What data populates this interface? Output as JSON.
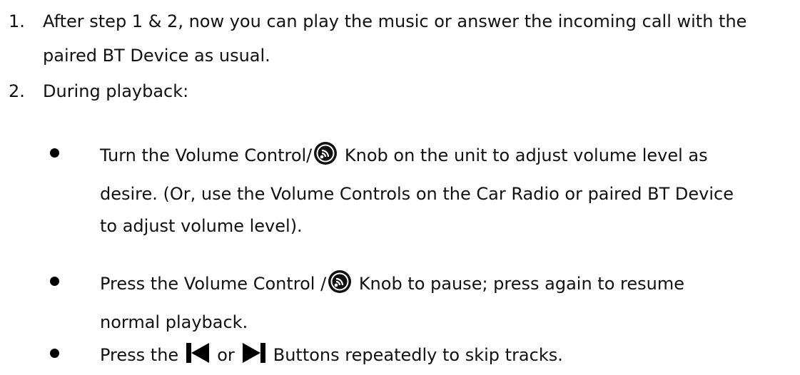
{
  "list": {
    "item1": {
      "number": "1.",
      "line1": "After step 1 & 2, now you can play the music or answer the incoming call with the",
      "line2": "paired BT Device as usual."
    },
    "item2": {
      "number": "2.",
      "title": "During playback:"
    }
  },
  "bullets": {
    "b1": {
      "part1": "Turn the Volume Control/",
      "part2": "Knob on the unit to adjust volume level as",
      "line2": "desire. (Or, use the Volume Controls on the Car Radio or paired BT Device",
      "line3": "to adjust volume level)."
    },
    "b2": {
      "part1": "Press the Volume Control /",
      "part2": "Knob to pause; press again to resume",
      "line2": "normal playback."
    },
    "b3": {
      "part1": "Press the",
      "part2": "or",
      "part3": "Buttons repeatedly to skip tracks."
    }
  },
  "icons": {
    "knob": "volume-knob-icon",
    "prev": "previous-track-icon",
    "next": "next-track-icon"
  }
}
